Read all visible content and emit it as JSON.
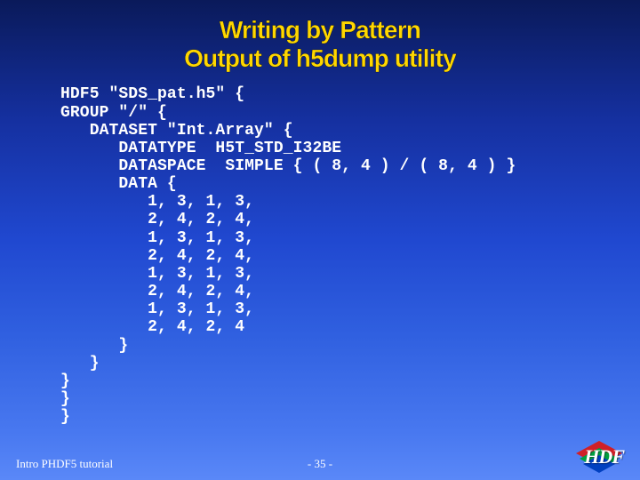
{
  "title": {
    "line1": "Writing by Pattern",
    "line2": "Output of h5dump utility"
  },
  "code": "HDF5 \"SDS_pat.h5\" {\nGROUP \"/\" {\n   DATASET \"Int.Array\" {\n      DATATYPE  H5T_STD_I32BE\n      DATASPACE  SIMPLE { ( 8, 4 ) / ( 8, 4 ) }\n      DATA {\n         1, 3, 1, 3,\n         2, 4, 2, 4,\n         1, 3, 1, 3,\n         2, 4, 2, 4,\n         1, 3, 1, 3,\n         2, 4, 2, 4,\n         1, 3, 1, 3,\n         2, 4, 2, 4\n      }\n   }\n}\n}\n}",
  "footer": {
    "left": "Intro PHDF5 tutorial",
    "center": "- 35 -"
  },
  "logo": {
    "text": "HDF"
  }
}
